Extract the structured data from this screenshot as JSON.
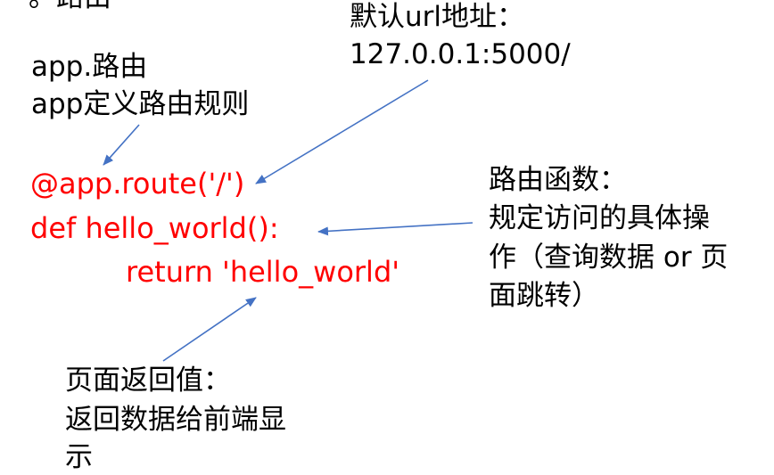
{
  "top_fragment": "。路由",
  "annotations": {
    "default_url": {
      "line1": "默认url地址：",
      "line2": "127.0.0.1:5000/"
    },
    "app_route": {
      "line1": "app.路由",
      "line2": "app定义路由规则"
    },
    "route_function": {
      "line1": "路由函数：",
      "line2": "规定访问的具体操",
      "line3": "作（查询数据 or 页",
      "line4": "面跳转）"
    },
    "return_value": {
      "line1": "页面返回值：",
      "line2": "返回数据给前端显",
      "line3": "示"
    }
  },
  "code": {
    "decorator": "@app.route('/')",
    "def_line": "def hello_world():",
    "return_line": "return 'hello_world'"
  },
  "colors": {
    "code": "#ff0000",
    "text": "#000000",
    "arrow": "#4472c4"
  }
}
